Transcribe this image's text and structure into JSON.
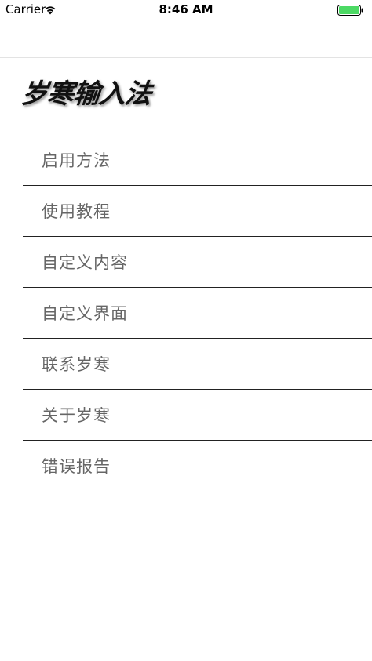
{
  "status_bar": {
    "carrier": "Carrier",
    "time": "8:46 AM",
    "battery_color": "#4cd964"
  },
  "logo": {
    "text": "岁寒输入法"
  },
  "menu": {
    "items": [
      {
        "label": "启用方法"
      },
      {
        "label": "使用教程"
      },
      {
        "label": "自定义内容"
      },
      {
        "label": "自定义界面"
      },
      {
        "label": "联系岁寒"
      },
      {
        "label": "关于岁寒"
      },
      {
        "label": "错误报告"
      }
    ]
  }
}
